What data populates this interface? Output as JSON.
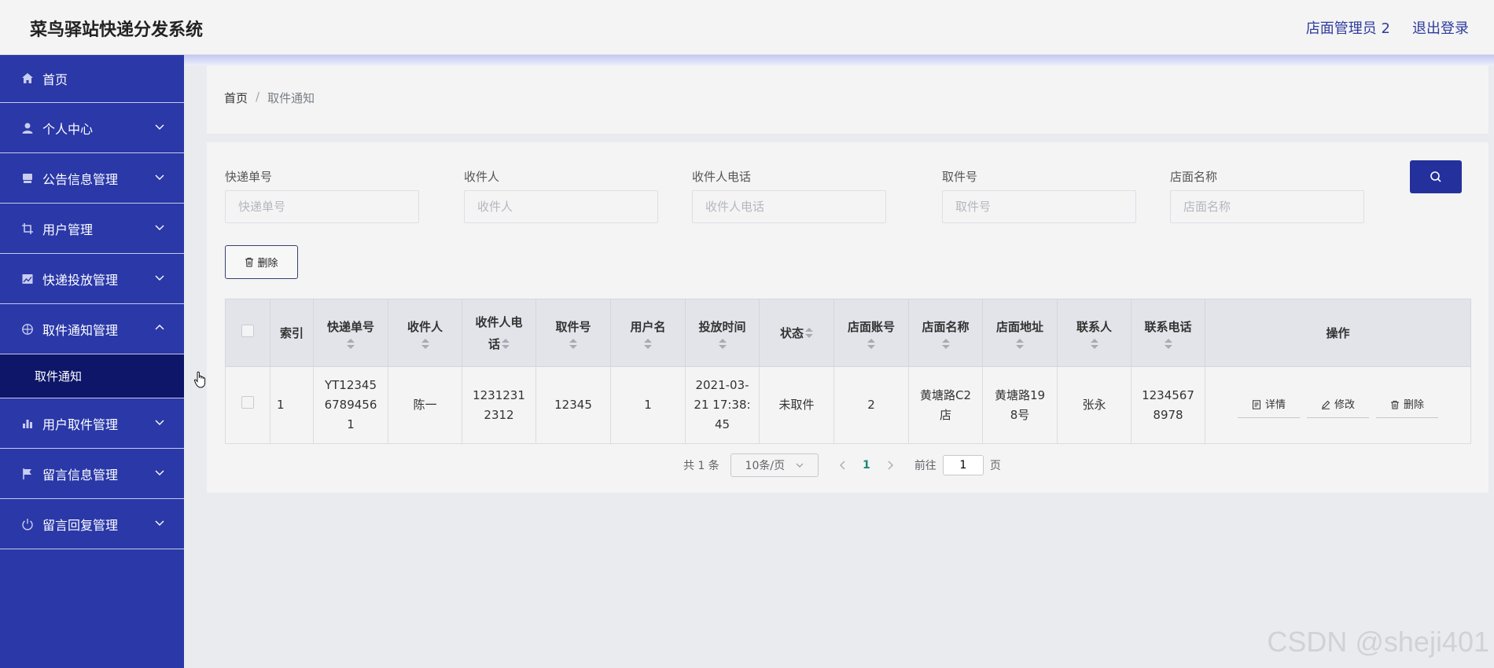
{
  "header": {
    "title": "菜鸟驿站快递分发系统",
    "user": "店面管理员 2",
    "logout": "退出登录"
  },
  "sidebar": {
    "items": [
      {
        "label": "首页",
        "icon": "home-icon"
      },
      {
        "label": "个人中心",
        "icon": "user-icon"
      },
      {
        "label": "公告信息管理",
        "icon": "monitor-icon"
      },
      {
        "label": "用户管理",
        "icon": "crop-icon"
      },
      {
        "label": "快递投放管理",
        "icon": "picture-icon"
      },
      {
        "label": "取件通知管理",
        "icon": "aperture-icon"
      },
      {
        "label": "用户取件管理",
        "icon": "bar-chart-icon"
      },
      {
        "label": "留言信息管理",
        "icon": "flag-icon"
      },
      {
        "label": "留言回复管理",
        "icon": "power-icon"
      }
    ],
    "submenu": {
      "label": "取件通知"
    }
  },
  "breadcrumb": {
    "home": "首页",
    "separator": "/",
    "current": "取件通知"
  },
  "search": {
    "tracking": {
      "label": "快递单号",
      "placeholder": "快递单号"
    },
    "recipient": {
      "label": "收件人",
      "placeholder": "收件人"
    },
    "phone": {
      "label": "收件人电话",
      "placeholder": "收件人电话"
    },
    "pickup": {
      "label": "取件号",
      "placeholder": "取件号"
    },
    "store": {
      "label": "店面名称",
      "placeholder": "店面名称"
    }
  },
  "toolbar": {
    "delete_label": "删除"
  },
  "table": {
    "headers": {
      "index": "索引",
      "tracking": "快递单号",
      "recipient": "收件人",
      "phone_l1": "收件人电",
      "phone_l2": "话",
      "pickup": "取件号",
      "username": "用户名",
      "time": "投放时间",
      "status": "状态",
      "store_account": "店面账号",
      "store_name": "店面名称",
      "store_addr": "店面地址",
      "contact": "联系人",
      "contact_phone": "联系电话",
      "actions": "操作"
    },
    "rows": [
      {
        "index": "1",
        "tracking_l1": "YT12345",
        "tracking_l2": "6789456",
        "tracking_l3": "1",
        "recipient": "陈一",
        "phone_l1": "1231231",
        "phone_l2": "2312",
        "pickup": "12345",
        "username": "1",
        "time_l1": "2021-03-",
        "time_l2": "21 17:38:",
        "time_l3": "45",
        "status": "未取件",
        "store_account": "2",
        "store_name_l1": "黄塘路C2",
        "store_name_l2": "店",
        "store_addr_l1": "黄塘路19",
        "store_addr_l2": "8号",
        "contact": "张永",
        "contact_phone_l1": "1234567",
        "contact_phone_l2": "8978",
        "detail": "详情",
        "edit": "修改",
        "delete": "删除"
      }
    ]
  },
  "pagination": {
    "total": "共 1 条",
    "page_size": "10条/页",
    "current": "1",
    "goto_prefix": "前往",
    "goto_value": "1",
    "goto_suffix": "页"
  },
  "watermark": "CSDN @sheji401",
  "colors": {
    "sidebar": "#2a38a8",
    "active_sub": "#0d1668",
    "accent": "#24319c"
  }
}
